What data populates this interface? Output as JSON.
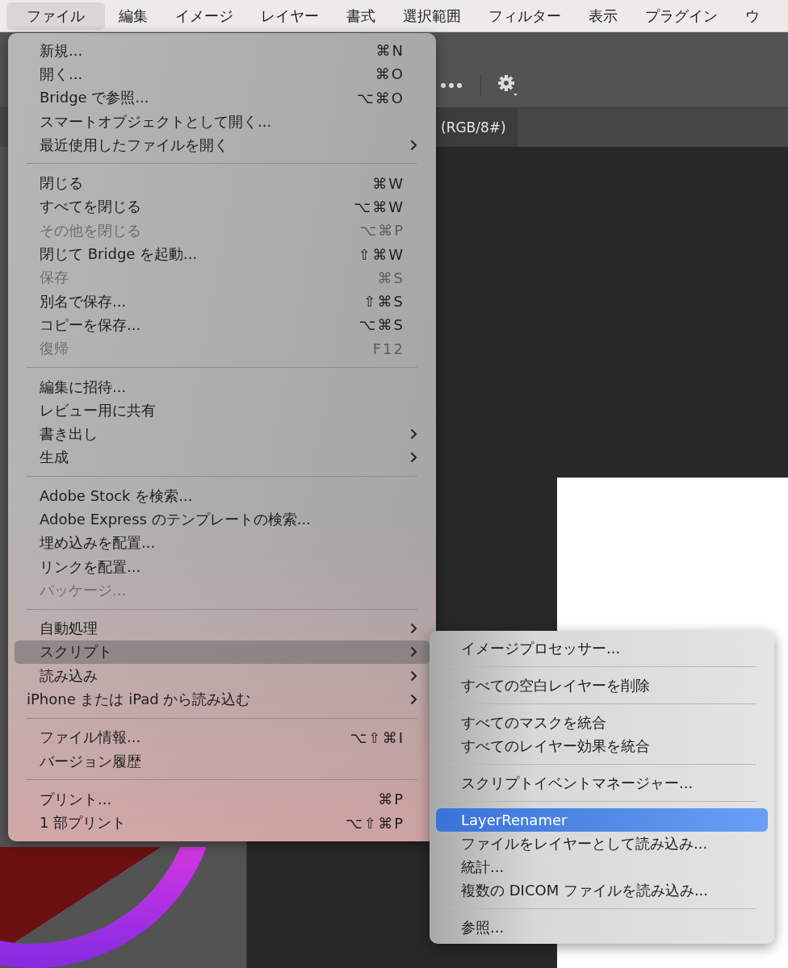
{
  "menubar": [
    {
      "label": "ファイル",
      "selected": true
    },
    {
      "label": "編集",
      "selected": false
    },
    {
      "label": "イメージ",
      "selected": false
    },
    {
      "label": "レイヤー",
      "selected": false
    },
    {
      "label": "書式",
      "selected": false
    },
    {
      "label": "選択範囲",
      "selected": false
    },
    {
      "label": "フィルター",
      "selected": false
    },
    {
      "label": "表示",
      "selected": false
    },
    {
      "label": "プラグイン",
      "selected": false
    },
    {
      "label": "ウ",
      "selected": false
    }
  ],
  "document_tab": {
    "label": "(RGB/8#)"
  },
  "file_menu": {
    "sections": [
      [
        {
          "kind": "plain",
          "label": "新規...",
          "shortcut": "⌘N",
          "disabled": false,
          "submenu": false,
          "selected": false
        },
        {
          "kind": "plain",
          "label": "開く...",
          "shortcut": "⌘O",
          "disabled": false,
          "submenu": false,
          "selected": false
        },
        {
          "kind": "plain",
          "label": "Bridge で参照...",
          "shortcut": "⌥⌘O",
          "disabled": false,
          "submenu": false,
          "selected": false
        },
        {
          "kind": "plain",
          "label": "スマートオブジェクトとして開く...",
          "disabled": false,
          "submenu": false,
          "selected": false
        },
        {
          "kind": "plain",
          "label": "最近使用したファイルを開く",
          "disabled": false,
          "submenu": true,
          "selected": false
        }
      ],
      [
        {
          "kind": "plain",
          "label": "閉じる",
          "shortcut": "⌘W",
          "disabled": false,
          "submenu": false,
          "selected": false
        },
        {
          "kind": "plain",
          "label": "すべてを閉じる",
          "shortcut": "⌥⌘W",
          "disabled": false,
          "submenu": false,
          "selected": false
        },
        {
          "kind": "plain",
          "label": "その他を閉じる",
          "shortcut": "⌥⌘P",
          "disabled": true,
          "submenu": false,
          "selected": false
        },
        {
          "kind": "plain",
          "label": "閉じて Bridge を起動...",
          "shortcut": "⇧⌘W",
          "disabled": false,
          "submenu": false,
          "selected": false
        },
        {
          "kind": "plain",
          "label": "保存",
          "shortcut": "⌘S",
          "disabled": true,
          "submenu": false,
          "selected": false
        },
        {
          "kind": "plain",
          "label": "別名で保存...",
          "shortcut": "⇧⌘S",
          "disabled": false,
          "submenu": false,
          "selected": false
        },
        {
          "kind": "plain",
          "label": "コピーを保存...",
          "shortcut": "⌥⌘S",
          "disabled": false,
          "submenu": false,
          "selected": false
        },
        {
          "kind": "plain",
          "label": "復帰",
          "shortcut": "F12",
          "disabled": true,
          "submenu": false,
          "selected": false
        }
      ],
      [
        {
          "kind": "plain",
          "label": "編集に招待...",
          "disabled": false,
          "submenu": false,
          "selected": false
        },
        {
          "kind": "plain",
          "label": "レビュー用に共有",
          "disabled": false,
          "submenu": false,
          "selected": false
        },
        {
          "kind": "plain",
          "label": "書き出し",
          "disabled": false,
          "submenu": true,
          "selected": false
        },
        {
          "kind": "plain",
          "label": "生成",
          "disabled": false,
          "submenu": true,
          "selected": false
        }
      ],
      [
        {
          "kind": "plain",
          "label": "Adobe Stock を検索...",
          "disabled": false,
          "submenu": false,
          "selected": false
        },
        {
          "kind": "plain",
          "label": "Adobe Express のテンプレートの検索...",
          "disabled": false,
          "submenu": false,
          "selected": false
        },
        {
          "kind": "plain",
          "label": "埋め込みを配置...",
          "disabled": false,
          "submenu": false,
          "selected": false
        },
        {
          "kind": "plain",
          "label": "リンクを配置...",
          "disabled": false,
          "submenu": false,
          "selected": false
        },
        {
          "kind": "plain",
          "label": "パッケージ...",
          "disabled": true,
          "submenu": false,
          "selected": false
        }
      ],
      [
        {
          "kind": "plain",
          "label": "自動処理",
          "disabled": false,
          "submenu": true,
          "selected": false
        },
        {
          "kind": "plain",
          "label": "スクリプト",
          "disabled": false,
          "submenu": true,
          "selected": true
        },
        {
          "kind": "plain",
          "label": "読み込み",
          "disabled": false,
          "submenu": true,
          "selected": false
        },
        {
          "kind": "flush",
          "label": "iPhone または iPad から読み込む",
          "disabled": false,
          "submenu": true,
          "selected": false
        }
      ],
      [
        {
          "kind": "plain",
          "label": "ファイル情報...",
          "shortcut": "⌥⇧⌘I",
          "disabled": false,
          "submenu": false,
          "selected": false
        },
        {
          "kind": "plain",
          "label": "バージョン履歴",
          "disabled": false,
          "submenu": false,
          "selected": false
        }
      ],
      [
        {
          "kind": "plain",
          "label": "プリント...",
          "shortcut": "⌘P",
          "disabled": false,
          "submenu": false,
          "selected": false
        },
        {
          "kind": "plain",
          "label": "1 部プリント",
          "shortcut": "⌥⇧⌘P",
          "disabled": false,
          "submenu": false,
          "selected": false
        }
      ]
    ]
  },
  "script_submenu": {
    "sections": [
      [
        {
          "label": "イメージプロセッサー...",
          "selected": false
        }
      ],
      [
        {
          "label": "すべての空白レイヤーを削除",
          "selected": false
        }
      ],
      [
        {
          "label": "すべてのマスクを統合",
          "selected": false
        },
        {
          "label": "すべてのレイヤー効果を統合",
          "selected": false
        }
      ],
      [
        {
          "label": "スクリプトイベントマネージャー...",
          "selected": false
        }
      ],
      [
        {
          "label": "LayerRenamer",
          "selected": true
        },
        {
          "label": "ファイルをレイヤーとして読み込み...",
          "selected": false
        },
        {
          "label": "統計...",
          "selected": false
        },
        {
          "label": "複数の DICOM ファイルを読み込み...",
          "selected": false
        }
      ],
      [
        {
          "label": "参照...",
          "selected": false
        }
      ]
    ]
  }
}
